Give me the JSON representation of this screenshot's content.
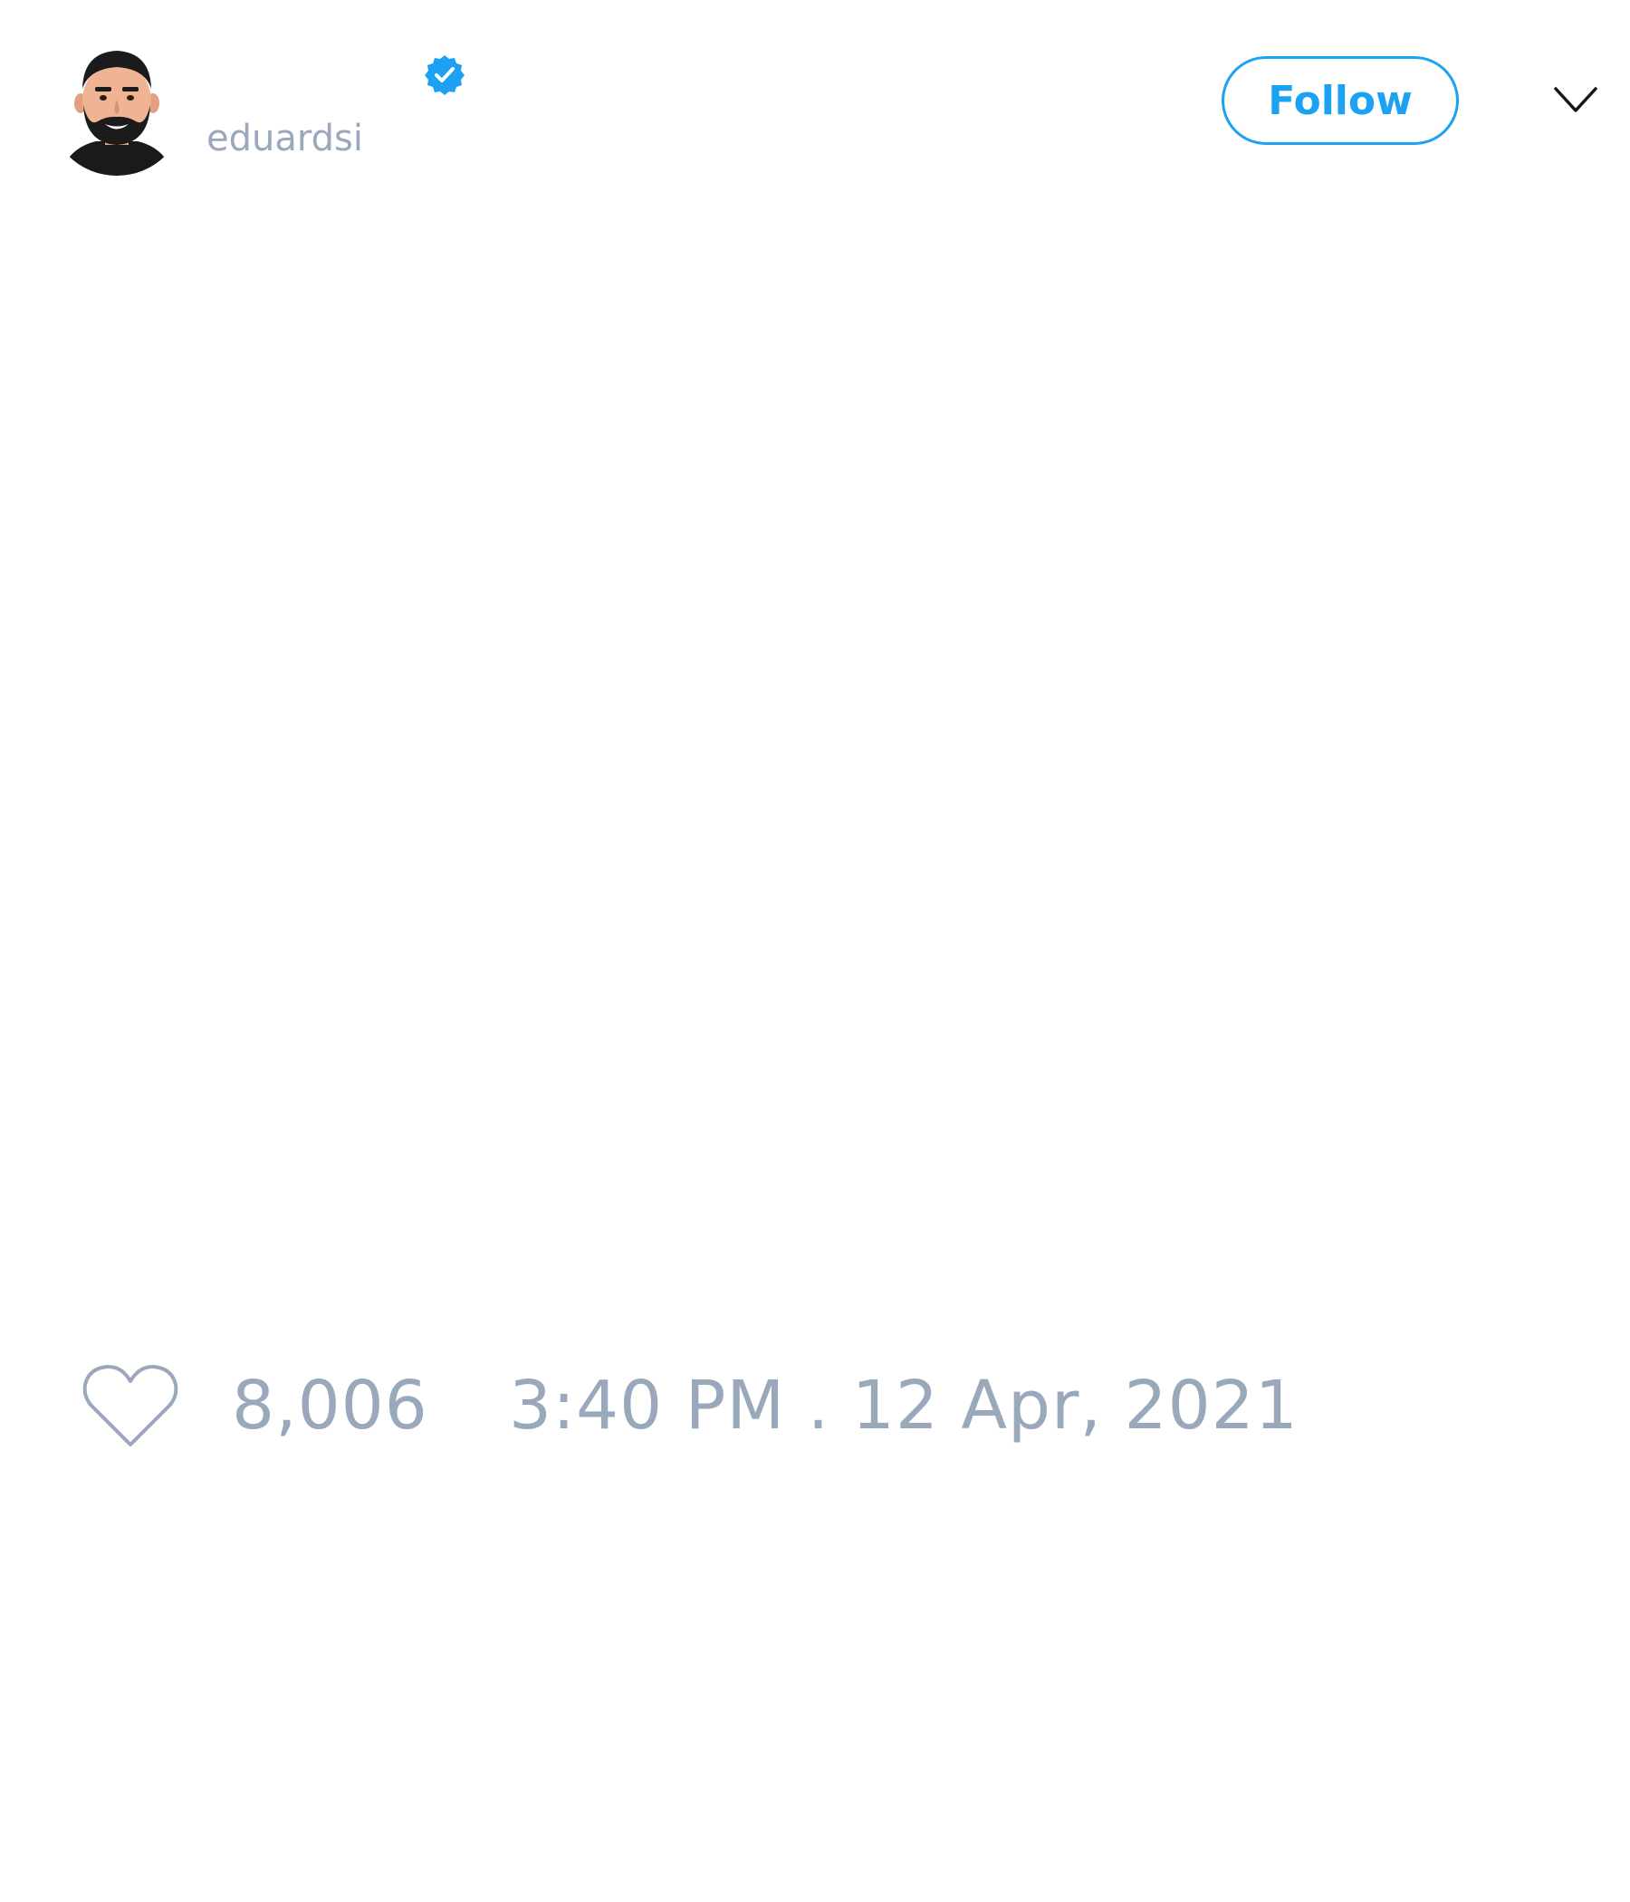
{
  "header": {
    "username": "eduardsi",
    "follow_label": "Follow",
    "verified": true
  },
  "icons": {
    "avatar": "avatar",
    "verified": "verified-badge-icon",
    "menu": "chevron-down-icon",
    "like": "heart-icon"
  },
  "stats": {
    "like_count": "8,006",
    "timestamp": "3:40 PM . 12 Apr, 2021"
  },
  "colors": {
    "accent": "#1da1f2",
    "muted_text": "#9aa8bb",
    "background": "#ffffff"
  }
}
